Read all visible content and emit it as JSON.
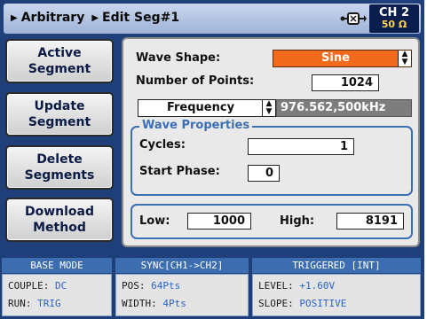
{
  "title_bar": {
    "crumbs": [
      "Arbitrary",
      "Edit Seg#1"
    ],
    "channel": "CH 2",
    "impedance": "50 Ω",
    "usb_icon": "usb-icon"
  },
  "side_buttons": [
    {
      "line1": "Active",
      "line2": "Segment"
    },
    {
      "line1": "Update",
      "line2": "Segment"
    },
    {
      "line1": "Delete",
      "line2": "Segments"
    },
    {
      "line1": "Download",
      "line2": "Method"
    }
  ],
  "main": {
    "wave_shape_label": "Wave Shape:",
    "wave_shape_value": "Sine",
    "num_points_label": "Number of Points:",
    "num_points_value": "1024",
    "freq_mode": "Frequency",
    "freq_value": "976.562,500kHz",
    "wave_props": {
      "title": "Wave Properties",
      "cycles_label": "Cycles:",
      "cycles_value": "1",
      "start_phase_label": "Start Phase:",
      "start_phase_value": "0"
    },
    "range": {
      "low_label": "Low:",
      "low_value": "1000",
      "high_label": "High:",
      "high_value": "8191"
    }
  },
  "status": {
    "base": {
      "header": "BASE MODE",
      "couple_key": "COUPLE:",
      "couple_val": "DC",
      "run_key": "RUN:",
      "run_val": "TRIG"
    },
    "sync": {
      "header": "SYNC[CH1->CH2]",
      "pos_key": "POS:",
      "pos_val": "64Pts",
      "width_key": "WIDTH:",
      "width_val": "4Pts"
    },
    "trig": {
      "header": "TRIGGERED [INT]",
      "level_key": "LEVEL:",
      "level_val": "+1.60V",
      "slope_key": "SLOPE:",
      "slope_val": "POSITIVE"
    }
  },
  "colors": {
    "frame": "#1f3f7a",
    "accent_orange": "#f26a1b",
    "group_border": "#3c6fb4",
    "status_value": "#2a63c8"
  }
}
